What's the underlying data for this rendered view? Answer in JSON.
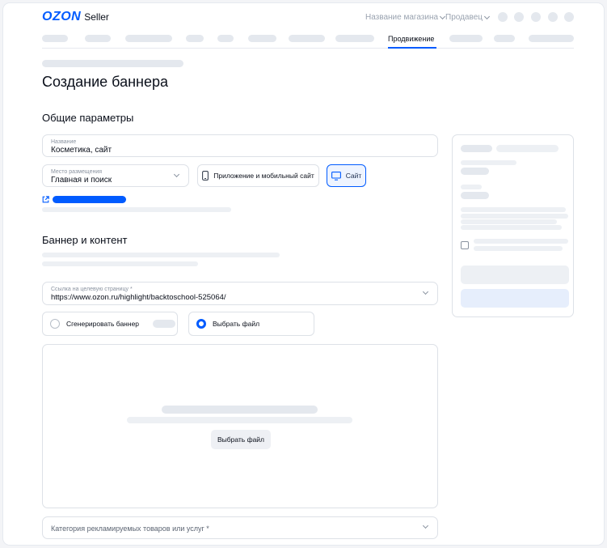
{
  "header": {
    "logo_brand": "OZON",
    "logo_product": "Seller",
    "store_name": "Название магазина",
    "seller_label": "Продавец",
    "active_tab": "Продвижение"
  },
  "page": {
    "title": "Создание баннера"
  },
  "general": {
    "heading": "Общие параметры",
    "name_label": "Название",
    "name_value": "Косметика, сайт",
    "placement_label": "Место размещения",
    "placement_value": "Главная и поиск",
    "option_app": "Приложение и мобильный сайт",
    "option_site": "Сайт"
  },
  "content": {
    "heading": "Баннер и контент",
    "url_label": "Ссылка на целевую страницу *",
    "url_value": "https://www.ozon.ru/highlight/backtoschool-525064/",
    "radio_generate": "Сгенерировать баннер",
    "radio_file": "Выбрать файл",
    "upload_button": "Выбрать файл",
    "category_placeholder": "Категория рекламируемых товаров или услуг *"
  },
  "icons": {
    "device": "smartphone-icon",
    "monitor": "monitor-icon",
    "external": "external-link-icon"
  },
  "colors": {
    "accent": "#005bff"
  }
}
